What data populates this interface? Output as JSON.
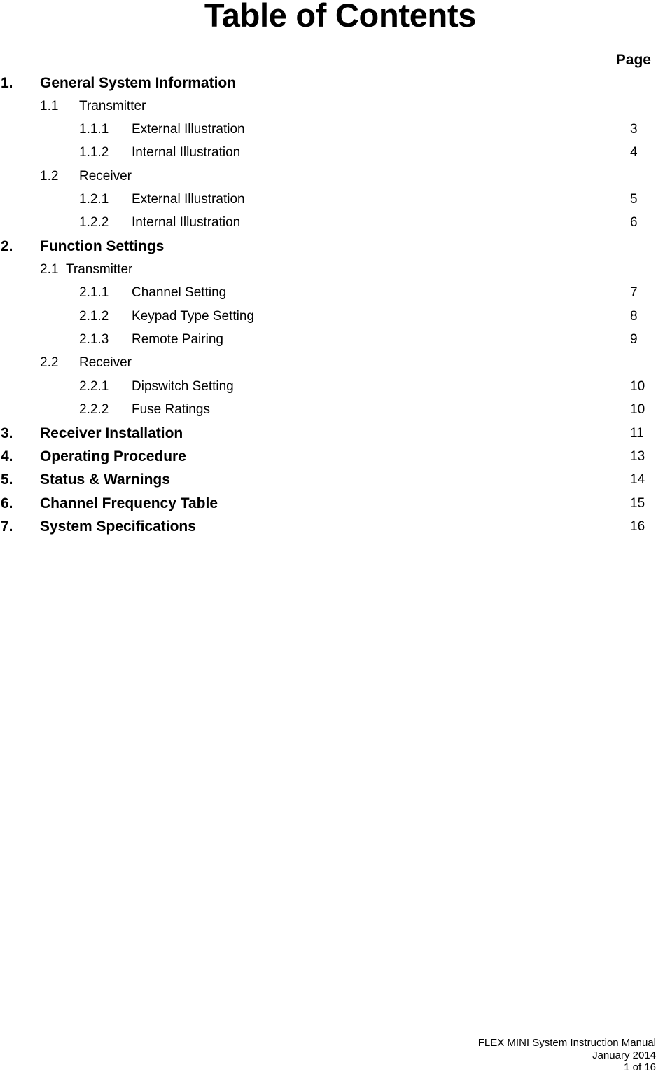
{
  "document": {
    "title": "Table of Contents",
    "page_column_header": "Page"
  },
  "toc": [
    {
      "level": 1,
      "number": "1.",
      "label": "General System Information",
      "page": ""
    },
    {
      "level": 2,
      "number": "1.1",
      "label": "Transmitter",
      "page": ""
    },
    {
      "level": 3,
      "number": "1.1.1",
      "label": "External Illustration",
      "page": "3"
    },
    {
      "level": 3,
      "number": "1.1.2",
      "label": "Internal Illustration",
      "page": "4"
    },
    {
      "level": 2,
      "number": "1.2",
      "label": "Receiver",
      "page": ""
    },
    {
      "level": 3,
      "number": "1.2.1",
      "label": "External Illustration",
      "page": "5"
    },
    {
      "level": 3,
      "number": "1.2.2",
      "label": "Internal Illustration",
      "page": "6"
    },
    {
      "level": 1,
      "number": "2.",
      "label": "Function Settings",
      "page": ""
    },
    {
      "level": 2,
      "number": "2.1",
      "label": "Transmitter",
      "page": ""
    },
    {
      "level": 3,
      "number": "2.1.1",
      "label": "Channel Setting",
      "page": "7"
    },
    {
      "level": 3,
      "number": "2.1.2",
      "label": "Keypad Type Setting",
      "page": "8"
    },
    {
      "level": 3,
      "number": "2.1.3",
      "label": "Remote Pairing",
      "page": "9"
    },
    {
      "level": 2,
      "number": "2.2",
      "label": "Receiver",
      "page": ""
    },
    {
      "level": 3,
      "number": "2.2.1",
      "label": "Dipswitch Setting",
      "page": "10"
    },
    {
      "level": 3,
      "number": "2.2.2",
      "label": "Fuse Ratings",
      "page": "10"
    },
    {
      "level": 1,
      "number": "3.",
      "label": "Receiver Installation",
      "page": "11"
    },
    {
      "level": 1,
      "number": "4.",
      "label": "Operating Procedure",
      "page": "13"
    },
    {
      "level": 1,
      "number": "5.",
      "label": "Status & Warnings",
      "page": "14"
    },
    {
      "level": 1,
      "number": "6.",
      "label": "Channel Frequency Table",
      "page": "15"
    },
    {
      "level": 1,
      "number": "7.",
      "label": "System Specifications",
      "page": "16"
    }
  ],
  "footer": {
    "manual_name": "FLEX MINI System Instruction Manual",
    "date": "January 2014",
    "page_indicator": "1 of 16"
  }
}
